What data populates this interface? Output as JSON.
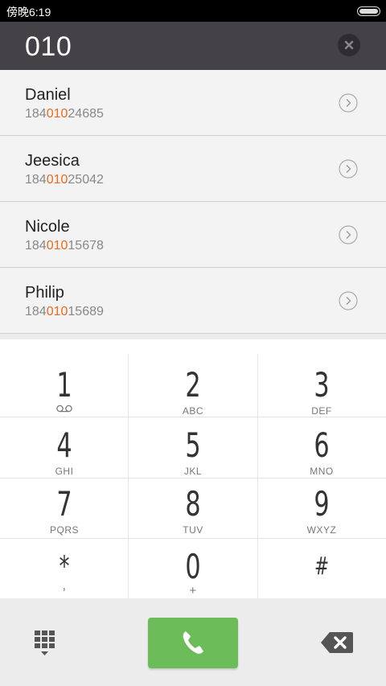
{
  "status": {
    "time": "傍晚6:19"
  },
  "dial": {
    "number": "010"
  },
  "matches": [
    {
      "name": "Daniel",
      "prefix": "184",
      "match": "010",
      "suffix": "24685"
    },
    {
      "name": "Jeesica",
      "prefix": "184",
      "match": "010",
      "suffix": "25042"
    },
    {
      "name": "Nicole",
      "prefix": "184",
      "match": "010",
      "suffix": "15678"
    },
    {
      "name": "Philip",
      "prefix": "184",
      "match": "010",
      "suffix": "15689"
    }
  ],
  "keys": [
    {
      "digit": "1",
      "letters": ""
    },
    {
      "digit": "2",
      "letters": "ABC"
    },
    {
      "digit": "3",
      "letters": "DEF"
    },
    {
      "digit": "4",
      "letters": "GHI"
    },
    {
      "digit": "5",
      "letters": "JKL"
    },
    {
      "digit": "6",
      "letters": "MNO"
    },
    {
      "digit": "7",
      "letters": "PQRS"
    },
    {
      "digit": "8",
      "letters": "TUV"
    },
    {
      "digit": "9",
      "letters": "WXYZ"
    },
    {
      "digit": "*",
      "letters": ","
    },
    {
      "digit": "0",
      "letters": "+"
    },
    {
      "digit": "#",
      "letters": ""
    }
  ],
  "colors": {
    "highlight": "#ea6a1f",
    "call": "#6cbd5a",
    "header": "#444247"
  },
  "icons": {
    "clear": "clear-circle-icon",
    "detail": "chevron-right-circle-icon",
    "voicemail": "voicemail-icon",
    "keypad": "dialpad-icon",
    "call": "phone-icon",
    "backspace": "backspace-icon"
  }
}
